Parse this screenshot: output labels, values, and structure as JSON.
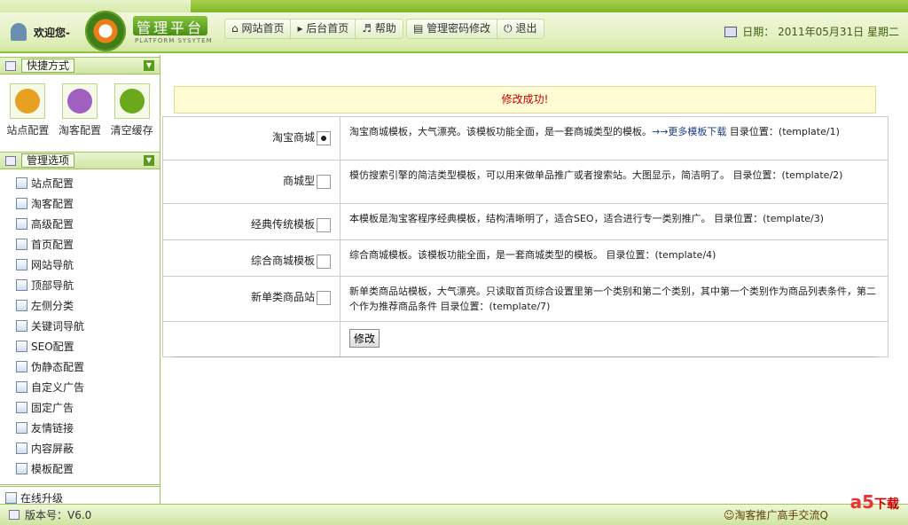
{
  "header": {
    "welcome": "欢迎您-",
    "logo_title": "管理平台",
    "logo_sub": "PLATFORM SYSYTEM",
    "nav": [
      {
        "label": "网站首页",
        "icon": "home-icon",
        "glyph": "⌂"
      },
      {
        "label": "后台首页",
        "icon": "play-icon",
        "glyph": "▸"
      },
      {
        "label": "帮助",
        "icon": "refresh-icon",
        "glyph": "♬"
      }
    ],
    "nav2": [
      {
        "label": "管理密码修改",
        "icon": "list-icon",
        "glyph": "▤"
      },
      {
        "label": "退出",
        "icon": "power-icon",
        "glyph": "⏻"
      }
    ],
    "date": "日期： 2011年05月31日 星期二"
  },
  "sidebar": {
    "shortcut_title": "快捷方式",
    "shortcuts": [
      {
        "label": "站点配置",
        "color": "#e8a020"
      },
      {
        "label": "淘客配置",
        "color": "#a060c0"
      },
      {
        "label": "清空缓存",
        "color": "#6aa81c"
      }
    ],
    "manage_title": "管理选项",
    "items": [
      "站点配置",
      "淘客配置",
      "高级配置",
      "首页配置",
      "网站导航",
      "顶部导航",
      "左侧分类",
      "关键词导航",
      "SEO配置",
      "伪静态配置",
      "自定义广告",
      "固定广告",
      "友情链接",
      "内容屏蔽",
      "模板配置"
    ],
    "upgrade": "在线升级"
  },
  "main": {
    "message": "修改成功!",
    "rows": [
      {
        "name": "淘宝商城",
        "checked": true,
        "desc": "淘宝商城模板，大气漂亮。该模板功能全面，是一套商城类型的模板。",
        "link": "→→更多模板下载",
        "loc": " 目录位置：(template/1)"
      },
      {
        "name": "商城型",
        "checked": false,
        "desc": "模仿搜索引擎的简洁类型模板，可以用来做单品推广或者搜索站。大图显示，简洁明了。",
        "link": "",
        "loc": " 目录位置：(template/2)"
      },
      {
        "name": "经典传统模板",
        "checked": false,
        "desc": "本模板是淘宝客程序经典模板，结构清晰明了，适合SEO，适合进行专一类别推广。",
        "link": "",
        "loc": " 目录位置：(template/3)"
      },
      {
        "name": "综合商城模板",
        "checked": false,
        "desc": "综合商城模板。该模板功能全面，是一套商城类型的模板。",
        "link": "",
        "loc": " 目录位置：(template/4)"
      },
      {
        "name": "新单类商品站",
        "checked": false,
        "desc": "新单类商品站模板，大气漂亮。只读取首页综合设置里第一个类别和第二个类别，其中第一个类别作为商品列表条件，第二个作为推荐商品条件",
        "link": "",
        "loc": " 目录位置：(template/7)"
      }
    ],
    "submit": "修改"
  },
  "footer": {
    "version": "版本号：V6.0",
    "right": "☺淘客推广高手交流Q",
    "watermark": "a5下载 xiazai.com"
  }
}
